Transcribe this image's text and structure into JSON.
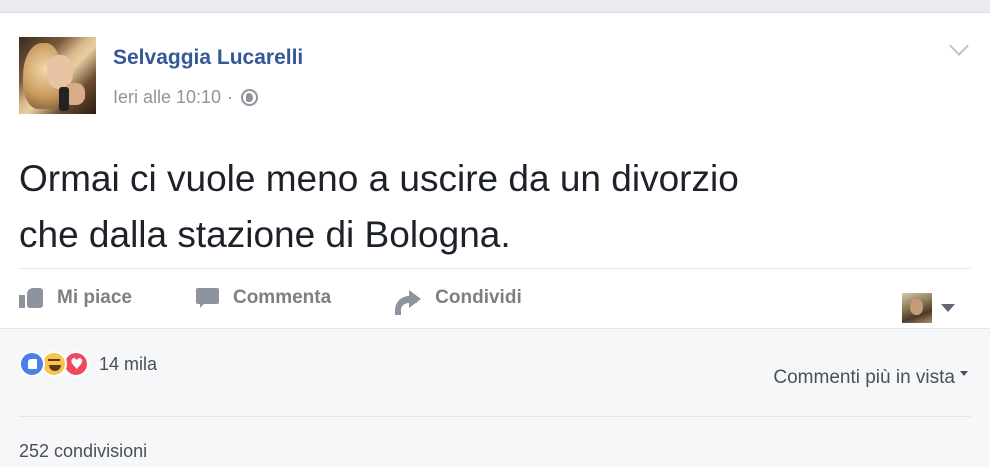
{
  "post": {
    "author": "Selvaggia Lucarelli",
    "timestamp": "Ieri alle 10:10",
    "separator": "·",
    "privacy_icon": "globe-icon",
    "text": "Ormai ci vuole meno a uscire da un divorzio\nche dalla stazione di Bologna."
  },
  "actions": {
    "like_label": "Mi piace",
    "comment_label": "Commenta",
    "share_label": "Condividi"
  },
  "footer": {
    "reactions": [
      "like",
      "haha",
      "love"
    ],
    "reaction_count": "14 mila",
    "sort_label": "Commenti più in vista",
    "shares_label": "252 condivisioni"
  },
  "colors": {
    "author": "#365899",
    "meta": "#90949c",
    "text": "#1d2129",
    "like_reaction": "#4a80e8",
    "haha_reaction": "#f7c54b",
    "love_reaction": "#ef4a5c"
  }
}
